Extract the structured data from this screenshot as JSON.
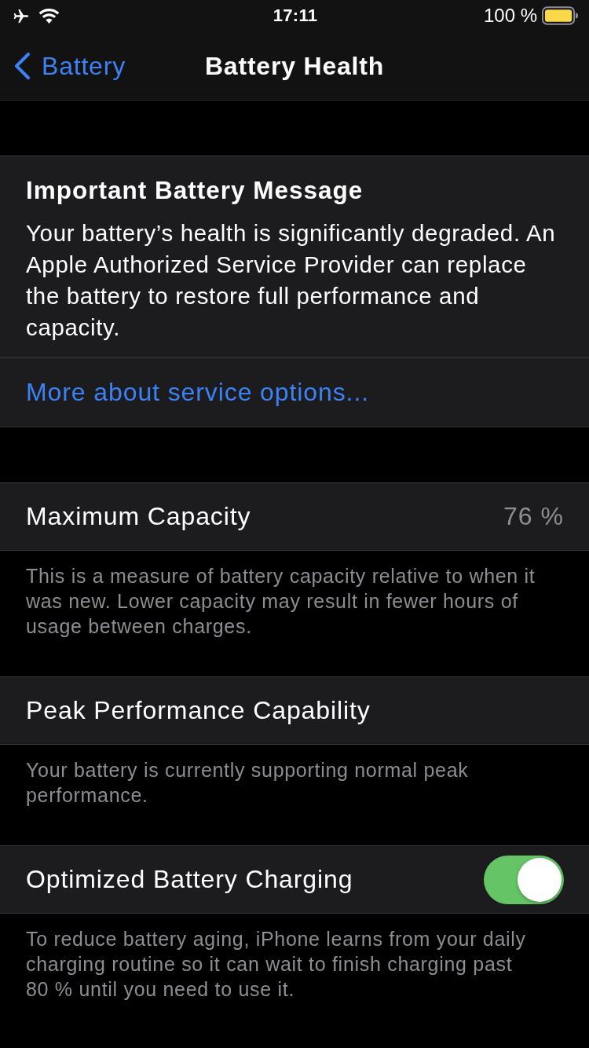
{
  "status_bar": {
    "time": "17:11",
    "battery_text": "100 %"
  },
  "nav_bar": {
    "back_label": "Battery",
    "title": "Battery Health"
  },
  "message_card": {
    "title": "Important Battery Message",
    "body": "Your battery’s health is significantly degraded. An Apple Authorized Service Provider can replace the battery to restore full performance and capacity.",
    "link": "More about service options..."
  },
  "sections": [
    {
      "kind": "value",
      "label": "Maximum Capacity",
      "value": "76 %",
      "footer": "This is a measure of battery capacity relative to when it was new. Lower capacity may result in fewer hours of usage between charges."
    },
    {
      "kind": "plain",
      "label": "Peak Performance Capability",
      "footer": "Your battery is currently supporting normal peak performance."
    },
    {
      "kind": "toggle",
      "label": "Optimized Battery Charging",
      "on": true,
      "footer": "To reduce battery aging, iPhone learns from your daily charging routine so it can wait to finish charging past 80 % until you need to use it."
    }
  ]
}
